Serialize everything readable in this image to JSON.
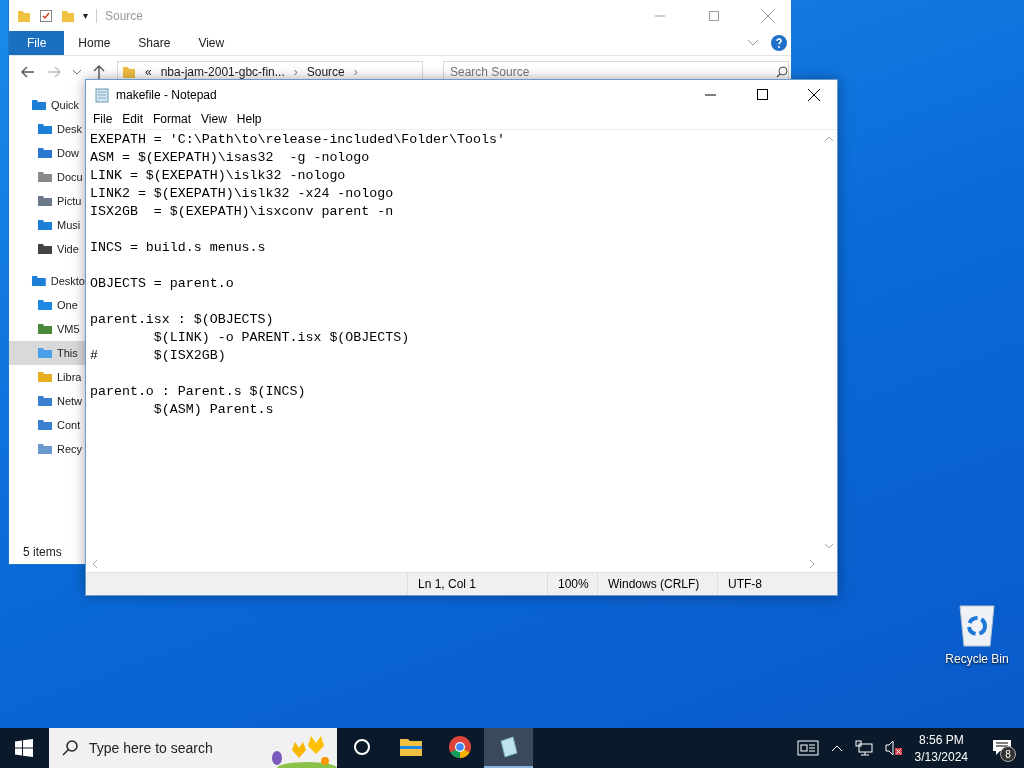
{
  "explorer": {
    "title": "Source",
    "quick_access_tools": [
      "▾"
    ],
    "ribbon_tabs": [
      {
        "label": "File",
        "selected": true
      },
      {
        "label": "Home",
        "selected": false
      },
      {
        "label": "Share",
        "selected": false
      },
      {
        "label": "View",
        "selected": false
      }
    ],
    "address": {
      "prefix": "«",
      "crumbs": [
        {
          "label": "nba-jam-2001-gbc-fin...",
          "separator": "›"
        },
        {
          "label": "Source",
          "separator": "›"
        }
      ]
    },
    "search": {
      "placeholder": "Search Source"
    },
    "nav": [
      {
        "label": "Quick",
        "selected": false,
        "children": [
          {
            "label": "Desk",
            "selected": false
          },
          {
            "label": "Dow",
            "selected": false
          },
          {
            "label": "Docu",
            "selected": false
          },
          {
            "label": "Pictu",
            "selected": false
          },
          {
            "label": "Musi",
            "selected": false
          },
          {
            "label": "Vide",
            "selected": false
          }
        ]
      },
      {
        "label": "Deskto",
        "selected": false,
        "children": [
          {
            "label": "One",
            "selected": false
          },
          {
            "label": "VM5",
            "selected": false
          },
          {
            "label": "This",
            "selected": true
          },
          {
            "label": "Libra",
            "selected": false
          },
          {
            "label": "Netw",
            "selected": false
          },
          {
            "label": "Cont",
            "selected": false
          },
          {
            "label": "Recy",
            "selected": false
          }
        ]
      }
    ],
    "status": "5 items"
  },
  "notepad": {
    "title": "makefile - Notepad",
    "menu": [
      "File",
      "Edit",
      "Format",
      "View",
      "Help"
    ],
    "text": "EXEPATH = 'C:\\Path\\to\\release-included\\Folder\\Tools'\nASM = $(EXEPATH)\\isas32  -g -nologo\nLINK = $(EXEPATH)\\islk32 -nologo\nLINK2 = $(EXEPATH)\\islk32 -x24 -nologo\nISX2GB  = $(EXEPATH)\\isxconv parent -n\n\nINCS = build.s menus.s\n\nOBJECTS = parent.o\n\nparent.isx : $(OBJECTS)\n        $(LINK) -o PARENT.isx $(OBJECTS)\n#       $(ISX2GB)\n\nparent.o : Parent.s $(INCS)\n        $(ASM) Parent.s",
    "status": [
      "Ln 1, Col 1",
      "100%",
      "Windows (CRLF)",
      "UTF-8"
    ]
  },
  "desktop_icons": [
    {
      "label": "Recycle Bin"
    }
  ],
  "taskbar": {
    "search_placeholder": "Type here to search",
    "apps": [
      {
        "kind": "cortana",
        "selected": false
      },
      {
        "kind": "explorer",
        "selected": false
      },
      {
        "kind": "chrome",
        "selected": false
      },
      {
        "kind": "notepad",
        "selected": true
      }
    ],
    "time": "8:56 PM",
    "date": "3/13/2024",
    "notifications": "8"
  }
}
